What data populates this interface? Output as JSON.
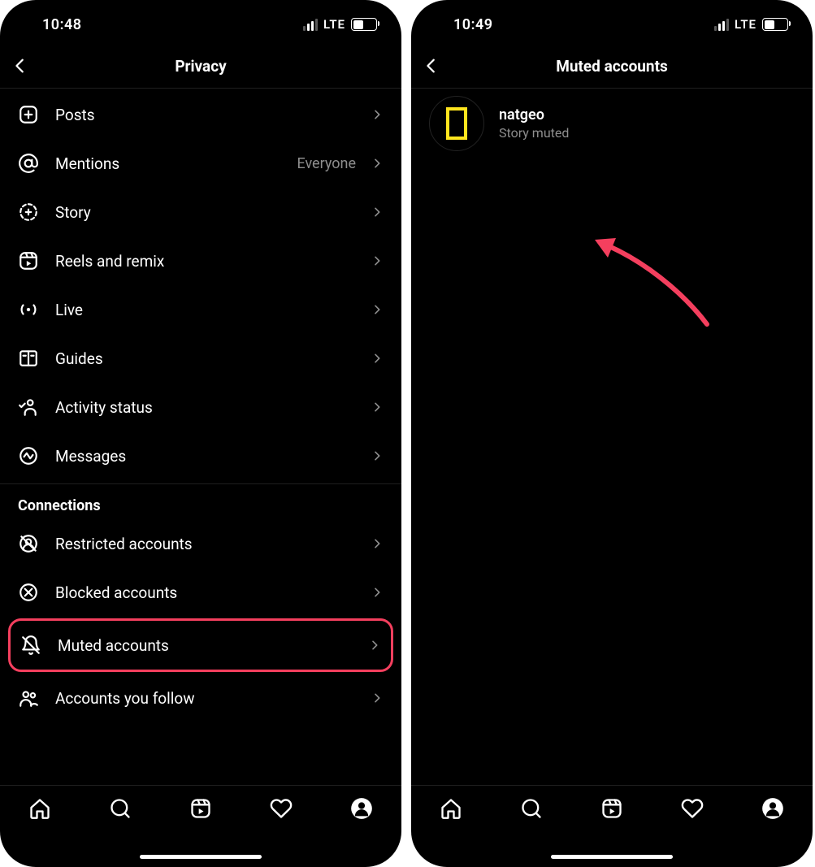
{
  "left": {
    "status": {
      "time": "10:48",
      "network": "LTE"
    },
    "header": {
      "title": "Privacy"
    },
    "items": [
      {
        "id": "posts",
        "icon": "posts-icon",
        "label": "Posts"
      },
      {
        "id": "mentions",
        "icon": "mentions-icon",
        "label": "Mentions",
        "value": "Everyone"
      },
      {
        "id": "story",
        "icon": "story-icon",
        "label": "Story"
      },
      {
        "id": "reels",
        "icon": "reels-icon",
        "label": "Reels and remix"
      },
      {
        "id": "live",
        "icon": "live-icon",
        "label": "Live"
      },
      {
        "id": "guides",
        "icon": "guides-icon",
        "label": "Guides"
      },
      {
        "id": "activity",
        "icon": "activity-icon",
        "label": "Activity status"
      },
      {
        "id": "messages",
        "icon": "messages-icon",
        "label": "Messages"
      }
    ],
    "connections_header": "Connections",
    "connections": [
      {
        "id": "restricted",
        "icon": "restricted-icon",
        "label": "Restricted accounts"
      },
      {
        "id": "blocked",
        "icon": "blocked-icon",
        "label": "Blocked accounts"
      },
      {
        "id": "muted",
        "icon": "muted-icon",
        "label": "Muted accounts",
        "highlight": true
      },
      {
        "id": "following",
        "icon": "following-icon",
        "label": "Accounts you follow"
      }
    ]
  },
  "right": {
    "status": {
      "time": "10:49",
      "network": "LTE"
    },
    "header": {
      "title": "Muted accounts"
    },
    "accounts": [
      {
        "username": "natgeo",
        "status": "Story muted",
        "avatar": "natgeo"
      }
    ]
  },
  "colors": {
    "highlight": "#f43f5e",
    "natgeo_yellow": "#ffe51e"
  }
}
